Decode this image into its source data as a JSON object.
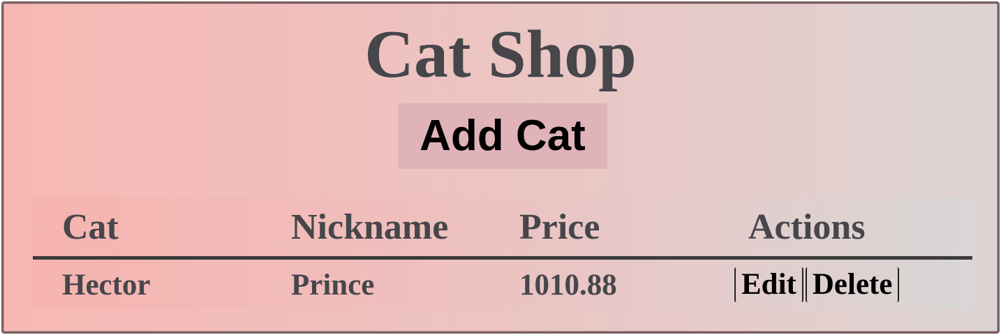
{
  "page": {
    "title": "Cat Shop",
    "add_button_label": "Add Cat"
  },
  "table": {
    "headers": [
      "Cat",
      "Nickname",
      "Price",
      "Actions"
    ],
    "rows": [
      {
        "cat": "Hector",
        "nickname": "Prince",
        "price": "1010.88",
        "actions": {
          "edit_label": "Edit",
          "delete_label": "Delete"
        }
      }
    ]
  },
  "colors": {
    "title_text": "#46464b",
    "button_bg": "#e0b3b9",
    "gradient_start": "#f7b8b4",
    "gradient_end": "#dcd4d4"
  }
}
